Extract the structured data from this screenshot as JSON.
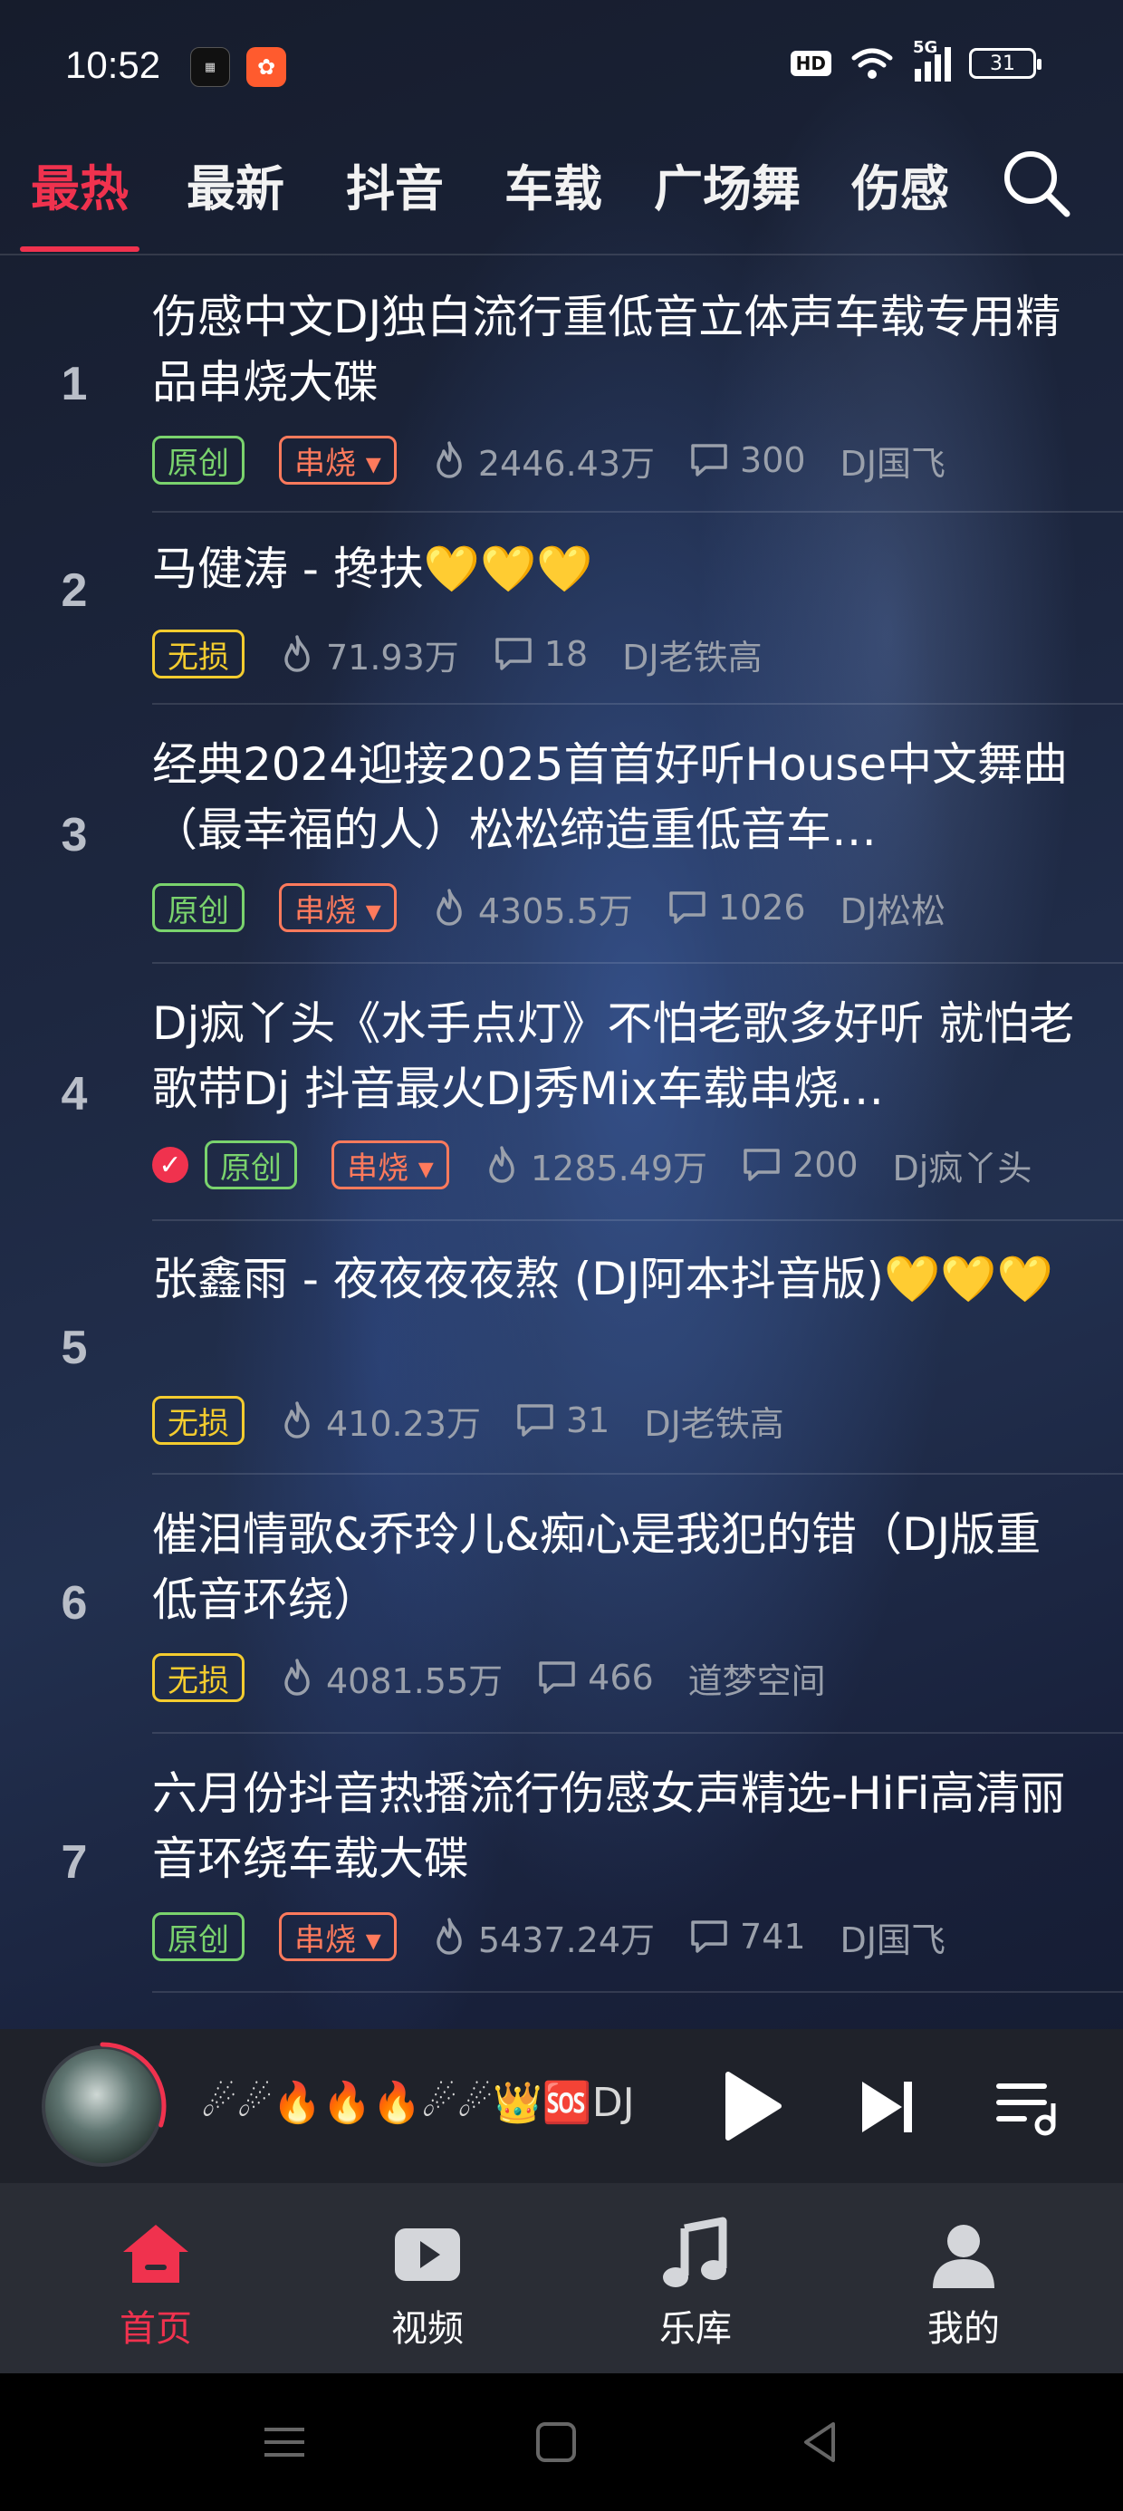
{
  "status_bar": {
    "time": "10:52",
    "network": "5G",
    "hd": "HD",
    "battery": "31"
  },
  "tabs": [
    {
      "label": "最热",
      "active": true
    },
    {
      "label": "最新",
      "active": false
    },
    {
      "label": "抖音",
      "active": false
    },
    {
      "label": "车载",
      "active": false
    },
    {
      "label": "广场舞",
      "active": false
    },
    {
      "label": "伤感",
      "active": false
    }
  ],
  "colors": {
    "accent": "#f0324e",
    "tag_original": "#7ad36d",
    "tag_medley": "#ff7a5c",
    "tag_lossless": "#f4cc2f"
  },
  "list": [
    {
      "rank": "1",
      "title": "伤感中文DJ独白流行重低音立体声车载专用精品串烧大碟",
      "verified": false,
      "tags": [
        "原创",
        "串烧 ▾"
      ],
      "plays": "2446.43万",
      "comments": "300",
      "author": "DJ国飞"
    },
    {
      "rank": "2",
      "title": "马健涛 - 搀扶💛💛💛",
      "verified": false,
      "tags": [
        "无损"
      ],
      "plays": "71.93万",
      "comments": "18",
      "author": "DJ老铁高"
    },
    {
      "rank": "3",
      "title": "经典2024迎接2025首首好听House中文舞曲（最幸福的人）松松缔造重低音车…",
      "verified": false,
      "tags": [
        "原创",
        "串烧 ▾"
      ],
      "plays": "4305.5万",
      "comments": "1026",
      "author": "DJ松松"
    },
    {
      "rank": "4",
      "title": "Dj疯丫头《水手点灯》不怕老歌多好听 就怕老歌带Dj 抖音最火DJ秀Mix车载串烧…",
      "verified": true,
      "tags": [
        "原创",
        "串烧 ▾"
      ],
      "plays": "1285.49万",
      "comments": "200",
      "author": "Dj疯丫头"
    },
    {
      "rank": "5",
      "title": "张鑫雨 - 夜夜夜夜熬 (DJ阿本抖音版)💛💛💛",
      "verified": false,
      "tags": [
        "无损"
      ],
      "plays": "410.23万",
      "comments": "31",
      "author": "DJ老铁高"
    },
    {
      "rank": "6",
      "title": "催泪情歌&乔玲儿&痴心是我犯的错（DJ版重低音环绕）",
      "verified": false,
      "tags": [
        "无损"
      ],
      "plays": "4081.55万",
      "comments": "466",
      "author": "道梦空间"
    },
    {
      "rank": "7",
      "title": "六月份抖音热播流行伤感女声精选-HiFi高清丽音环绕车载大碟",
      "verified": false,
      "tags": [
        "原创",
        "串烧 ▾"
      ],
      "plays": "5437.24万",
      "comments": "741",
      "author": "DJ国飞"
    }
  ],
  "player": {
    "now_playing": "☄☄🔥🔥🔥☄☄👑🆘DJ",
    "progress": 0.3
  },
  "bottom_nav": [
    {
      "label": "首页",
      "icon": "home-icon",
      "active": true
    },
    {
      "label": "视频",
      "icon": "video-icon",
      "active": false
    },
    {
      "label": "乐库",
      "icon": "music-note-icon",
      "active": false
    },
    {
      "label": "我的",
      "icon": "profile-icon",
      "active": false
    }
  ]
}
